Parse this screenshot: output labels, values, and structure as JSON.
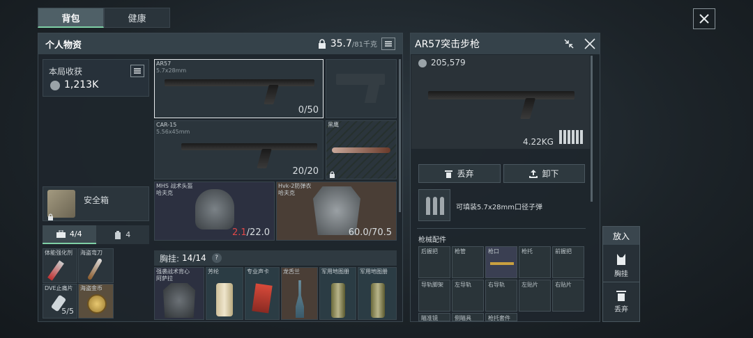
{
  "tabs": {
    "backpack": "背包",
    "health": "健康"
  },
  "personal": {
    "title": "个人物资",
    "weight_current": "35.7",
    "weight_max": "/81千克"
  },
  "harvest": {
    "label": "本局收获",
    "value": "1,213K"
  },
  "safe_box": {
    "label": "安全箱"
  },
  "case_tabs": {
    "a": "4/4",
    "b": "4"
  },
  "small_items": [
    {
      "name": "体能强化剂"
    },
    {
      "name": "海盗弯刀"
    },
    {
      "name": "DVE止痛片",
      "count": "5/5"
    },
    {
      "name": "海盗金币"
    }
  ],
  "weapons": {
    "primary": {
      "name": "AR57",
      "ammo": "5.7x28mm",
      "count": "0/50"
    },
    "secondary": {
      "name": "CAR-15",
      "ammo": "5.56x45mm",
      "count": "20/20"
    },
    "knife": {
      "name": "黑鹰"
    }
  },
  "helmet": {
    "name": "MHS 战术头盔",
    "sub": "哈夫克",
    "durability_cur": "2.1",
    "durability_max": "/22.0"
  },
  "armor": {
    "name": "Hvk-2防弹衣",
    "sub": "哈夫克",
    "durability": "60.0/70.5"
  },
  "chest_rig": {
    "label": "胸挂:",
    "capacity": "14/14",
    "help": "?",
    "items": [
      {
        "name": "强袭战术背心",
        "sub": "阿萨拉"
      },
      {
        "name": "芳纶"
      },
      {
        "name": "专业声卡"
      },
      {
        "name": "龙舌兰"
      },
      {
        "name": "军用地图册"
      },
      {
        "name": "军用地图册"
      }
    ]
  },
  "detail": {
    "title": "AR57突击步枪",
    "price": "205,579",
    "weight": "4.22KG",
    "discard": "丢弃",
    "unload": "卸下",
    "ammo_info": "可填装5.7x28mm口径子弹",
    "attachments_title": "枪械配件",
    "slots": [
      "后握把",
      "枪管",
      "枪口",
      "枪托",
      "前握把",
      "导轨脚架",
      "左导轨",
      "右导轨",
      "左贴片",
      "右贴片",
      "瞄准镜",
      "侧瞄具",
      "枪托套件"
    ]
  },
  "side_actions": {
    "title": "放入",
    "chest": "胸挂",
    "discard": "丢弃"
  },
  "colors": {
    "accent": "#7fd0a6",
    "durability_low": "#e24848"
  }
}
